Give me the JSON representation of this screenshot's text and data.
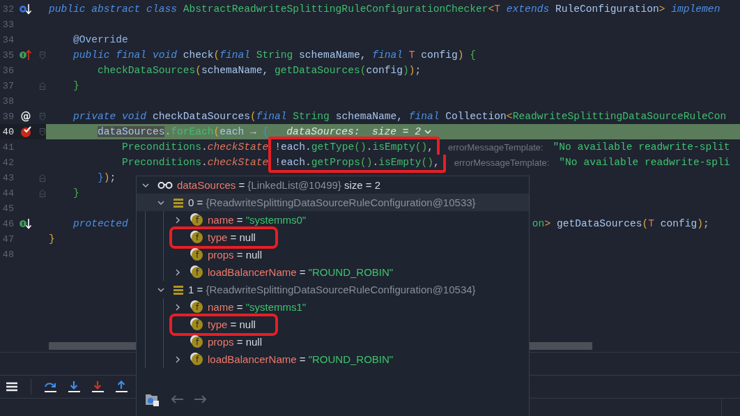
{
  "editor": {
    "lines": [
      {
        "number": "32",
        "gutter": {
          "kind": "class-overridden"
        },
        "current": false,
        "tokens": [
          {
            "text": "public abstract class ",
            "kind": "kw"
          },
          {
            "text": "AbstractReadwriteSplittingRuleConfigurationChecker",
            "kind": "type"
          },
          {
            "text": "<",
            "kind": "generic"
          },
          {
            "text": "T",
            "kind": "tparam"
          },
          {
            "text": " extends ",
            "kind": "kw"
          },
          {
            "text": "RuleConfiguration",
            "kind": "ident"
          },
          {
            "text": "> ",
            "kind": "generic"
          },
          {
            "text": "implemen",
            "kind": "kw"
          }
        ]
      },
      {
        "number": "33",
        "current": false
      },
      {
        "number": "34",
        "current": false,
        "tokens": [
          {
            "text": "    @Override",
            "kind": "annotation"
          }
        ]
      },
      {
        "number": "35",
        "gutter": {
          "kind": "method-implements"
        },
        "fold": {
          "kind": "start"
        },
        "current": false,
        "tokens": [
          {
            "text": "    public final void ",
            "kind": "kw"
          },
          {
            "text": "check",
            "kind": "ident"
          },
          {
            "text": "(",
            "kind": "b1"
          },
          {
            "text": "final ",
            "kind": "kw"
          },
          {
            "text": "String ",
            "kind": "type"
          },
          {
            "text": "schemaName, ",
            "kind": "ident"
          },
          {
            "text": "final ",
            "kind": "kw"
          },
          {
            "text": "T",
            "kind": "tparam"
          },
          {
            "text": " config",
            "kind": "ident"
          },
          {
            "text": ") ",
            "kind": "b1"
          },
          {
            "text": "{",
            "kind": "b2"
          }
        ]
      },
      {
        "number": "36",
        "current": false,
        "tokens": [
          {
            "text": "        checkDataSources",
            "kind": "method"
          },
          {
            "text": "(",
            "kind": "b1"
          },
          {
            "text": "schemaName, ",
            "kind": "ident"
          },
          {
            "text": "getDataSources",
            "kind": "method"
          },
          {
            "text": "(",
            "kind": "b2"
          },
          {
            "text": "config",
            "kind": "ident"
          },
          {
            "text": ")",
            "kind": "b2"
          },
          {
            "text": ")",
            "kind": "b1"
          },
          {
            "text": ";",
            "kind": "punct"
          }
        ]
      },
      {
        "number": "37",
        "fold": {
          "kind": "end"
        },
        "current": false,
        "tokens": [
          {
            "text": "    }",
            "kind": "b2"
          }
        ]
      },
      {
        "number": "38",
        "current": false
      },
      {
        "number": "39",
        "gutter_text": "@",
        "fold": {
          "kind": "start"
        },
        "current": false,
        "tokens": [
          {
            "text": "    private void ",
            "kind": "kw"
          },
          {
            "text": "checkDataSources",
            "kind": "ident"
          },
          {
            "text": "(",
            "kind": "b1"
          },
          {
            "text": "final ",
            "kind": "kw"
          },
          {
            "text": "String ",
            "kind": "type"
          },
          {
            "text": "schemaName, ",
            "kind": "ident"
          },
          {
            "text": "final ",
            "kind": "kw"
          },
          {
            "text": "Collection",
            "kind": "ident"
          },
          {
            "text": "<",
            "kind": "generic"
          },
          {
            "text": "ReadwriteSplittingDataSourceRuleCon",
            "kind": "type"
          }
        ]
      },
      {
        "number": "40",
        "gutter": {
          "kind": "breakpoint"
        },
        "fold": {
          "kind": "start"
        },
        "current": true,
        "tokens": [
          {
            "text": "        dataSources",
            "kind": "selected-ident"
          },
          {
            "text": ".",
            "kind": "punct"
          },
          {
            "text": "forEach",
            "kind": "method"
          },
          {
            "text": "(",
            "kind": "b1"
          },
          {
            "text": "each ",
            "kind": "ident"
          },
          {
            "text": "→ ",
            "kind": "punct"
          },
          {
            "text": "{",
            "kind": "b3"
          },
          {
            "text": "dataSources:  size = 2",
            "kind": "debug"
          }
        ]
      },
      {
        "number": "41",
        "current": false,
        "tokens": [
          {
            "text": "            Preconditions",
            "kind": "type"
          },
          {
            "text": ".",
            "kind": "punct"
          },
          {
            "text": "checkState",
            "kind": "static"
          },
          {
            "kind": "group",
            "marked": true,
            "box": {
              "kind": "top"
            },
            "tokens": [
              {
                "text": "!each",
                "kind": "ident"
              },
              {
                "text": ".",
                "kind": "punct"
              },
              {
                "text": "getType",
                "kind": "method"
              },
              {
                "text": "()",
                "kind": "b2"
              },
              {
                "text": ".",
                "kind": "punct"
              },
              {
                "text": "isEmpty",
                "kind": "method"
              },
              {
                "text": "()",
                "kind": "b2"
              },
              {
                "text": ",",
                "kind": "punct"
              }
            ]
          },
          {
            "text": "errorMessageTemplate:",
            "kind": "hint"
          },
          {
            "text": "\"No available readwrite-split",
            "kind": "string"
          }
        ]
      },
      {
        "number": "42",
        "current": false,
        "tokens": [
          {
            "text": "            Preconditions",
            "kind": "type"
          },
          {
            "text": ".",
            "kind": "punct"
          },
          {
            "text": "checkState",
            "kind": "static"
          },
          {
            "kind": "group",
            "marked": true,
            "box": {
              "kind": "bottom"
            },
            "tokens": [
              {
                "text": "!each",
                "kind": "ident"
              },
              {
                "text": ".",
                "kind": "punct"
              },
              {
                "text": "getProps",
                "kind": "method"
              },
              {
                "text": "()",
                "kind": "b2"
              },
              {
                "text": ".",
                "kind": "punct"
              },
              {
                "text": "isEmpty",
                "kind": "method"
              },
              {
                "text": "()",
                "kind": "b2"
              },
              {
                "text": ",",
                "kind": "punct"
              }
            ]
          },
          {
            "text": "errorMessageTemplate:",
            "kind": "hint"
          },
          {
            "text": "\"No available readwrite-spli",
            "kind": "string"
          }
        ]
      },
      {
        "number": "43",
        "fold": {
          "kind": "end"
        },
        "current": false,
        "tokens": [
          {
            "text": "        }",
            "kind": "b3"
          },
          {
            "text": ")",
            "kind": "b1"
          },
          {
            "text": ";",
            "kind": "punct"
          }
        ]
      },
      {
        "number": "44",
        "fold": {
          "kind": "end"
        },
        "current": false,
        "tokens": [
          {
            "text": "    }",
            "kind": "b2"
          }
        ]
      },
      {
        "number": "45",
        "current": false
      },
      {
        "number": "46",
        "gutter": {
          "kind": "method-implemented"
        },
        "current": false,
        "tokens": [
          {
            "text": "    protected",
            "kind": "kw"
          }
        ],
        "tail": [
          {
            "text": "on",
            "kind": "type"
          },
          {
            "text": "> ",
            "kind": "generic"
          },
          {
            "text": "getDataSources",
            "kind": "ident"
          },
          {
            "text": "(",
            "kind": "b1"
          },
          {
            "text": "T",
            "kind": "tparam"
          },
          {
            "text": " config",
            "kind": "ident"
          },
          {
            "text": ")",
            "kind": "b1"
          },
          {
            "text": ";",
            "kind": "punct"
          }
        ]
      },
      {
        "number": "47",
        "current": false,
        "tokens": [
          {
            "text": "}",
            "kind": "b1"
          }
        ]
      },
      {
        "number": "48",
        "current": false
      }
    ]
  },
  "popup": {
    "root": {
      "kind": "variable",
      "name": "dataSources",
      "op": "=",
      "value": {
        "text": "{LinkedList@10499}",
        "kind": "object"
      },
      "extra": "size = 2",
      "expanded": true,
      "selected": false,
      "children": [
        {
          "kind": "element",
          "name": "0",
          "op": "=",
          "value": {
            "text": "{ReadwriteSplittingDataSourceRuleConfiguration@10533}",
            "kind": "object"
          },
          "expanded": true,
          "selected": true,
          "children": [
            {
              "kind": "field",
              "badge": "f",
              "name": "name",
              "op": "=",
              "value": {
                "text": "\"systemms0\"",
                "kind": "string"
              },
              "expanded": false,
              "selected": false
            },
            {
              "kind": "field",
              "badge": "f",
              "name": "type",
              "op": "=",
              "value": {
                "text": "null",
                "kind": "null"
              },
              "selected": false,
              "marked": true
            },
            {
              "kind": "field",
              "badge": "f",
              "name": "props",
              "op": "=",
              "value": {
                "text": "null",
                "kind": "null"
              },
              "selected": false
            },
            {
              "kind": "field",
              "badge": "f",
              "name": "loadBalancerName",
              "op": "=",
              "value": {
                "text": "\"ROUND_ROBIN\"",
                "kind": "string"
              },
              "expanded": false,
              "selected": false
            }
          ]
        },
        {
          "kind": "element",
          "name": "1",
          "op": "=",
          "value": {
            "text": "{ReadwriteSplittingDataSourceRuleConfiguration@10534}",
            "kind": "object"
          },
          "expanded": true,
          "selected": false,
          "children": [
            {
              "kind": "field",
              "badge": "f",
              "name": "name",
              "op": "=",
              "value": {
                "text": "\"systemms1\"",
                "kind": "string"
              },
              "expanded": false,
              "selected": false
            },
            {
              "kind": "field",
              "badge": "f",
              "name": "type",
              "op": "=",
              "value": {
                "text": "null",
                "kind": "null"
              },
              "selected": false,
              "marked": true
            },
            {
              "kind": "field",
              "badge": "f",
              "name": "props",
              "op": "=",
              "value": {
                "text": "null",
                "kind": "null"
              },
              "selected": false
            },
            {
              "kind": "field",
              "badge": "f",
              "name": "loadBalancerName",
              "op": "=",
              "value": {
                "text": "\"ROUND_ROBIN\"",
                "kind": "string"
              },
              "expanded": false,
              "selected": false
            }
          ]
        }
      ]
    }
  }
}
